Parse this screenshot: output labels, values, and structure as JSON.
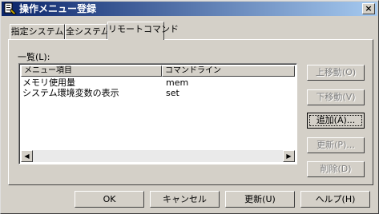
{
  "window": {
    "title": "操作メニュー登録",
    "close_glyph": "×"
  },
  "tabs": [
    {
      "label": "指定システム",
      "selected": false
    },
    {
      "label": "全システム",
      "selected": false
    },
    {
      "label": "リモートコマンド",
      "selected": true
    }
  ],
  "list": {
    "label": "一覧(L):",
    "columns": [
      "メニュー項目",
      "コマンドライン"
    ],
    "rows": [
      [
        "メモリ使用量",
        "mem"
      ],
      [
        "システム環境変数の表示",
        "set"
      ]
    ]
  },
  "side_buttons": {
    "move_up": "上移動(O)",
    "move_down": "下移動(V)",
    "add": "追加(A)...",
    "update": "更新(P)...",
    "delete": "削除(D)"
  },
  "footer": {
    "ok": "OK",
    "cancel": "キャンセル",
    "update": "更新(U)",
    "help": "ヘルプ(H)"
  }
}
